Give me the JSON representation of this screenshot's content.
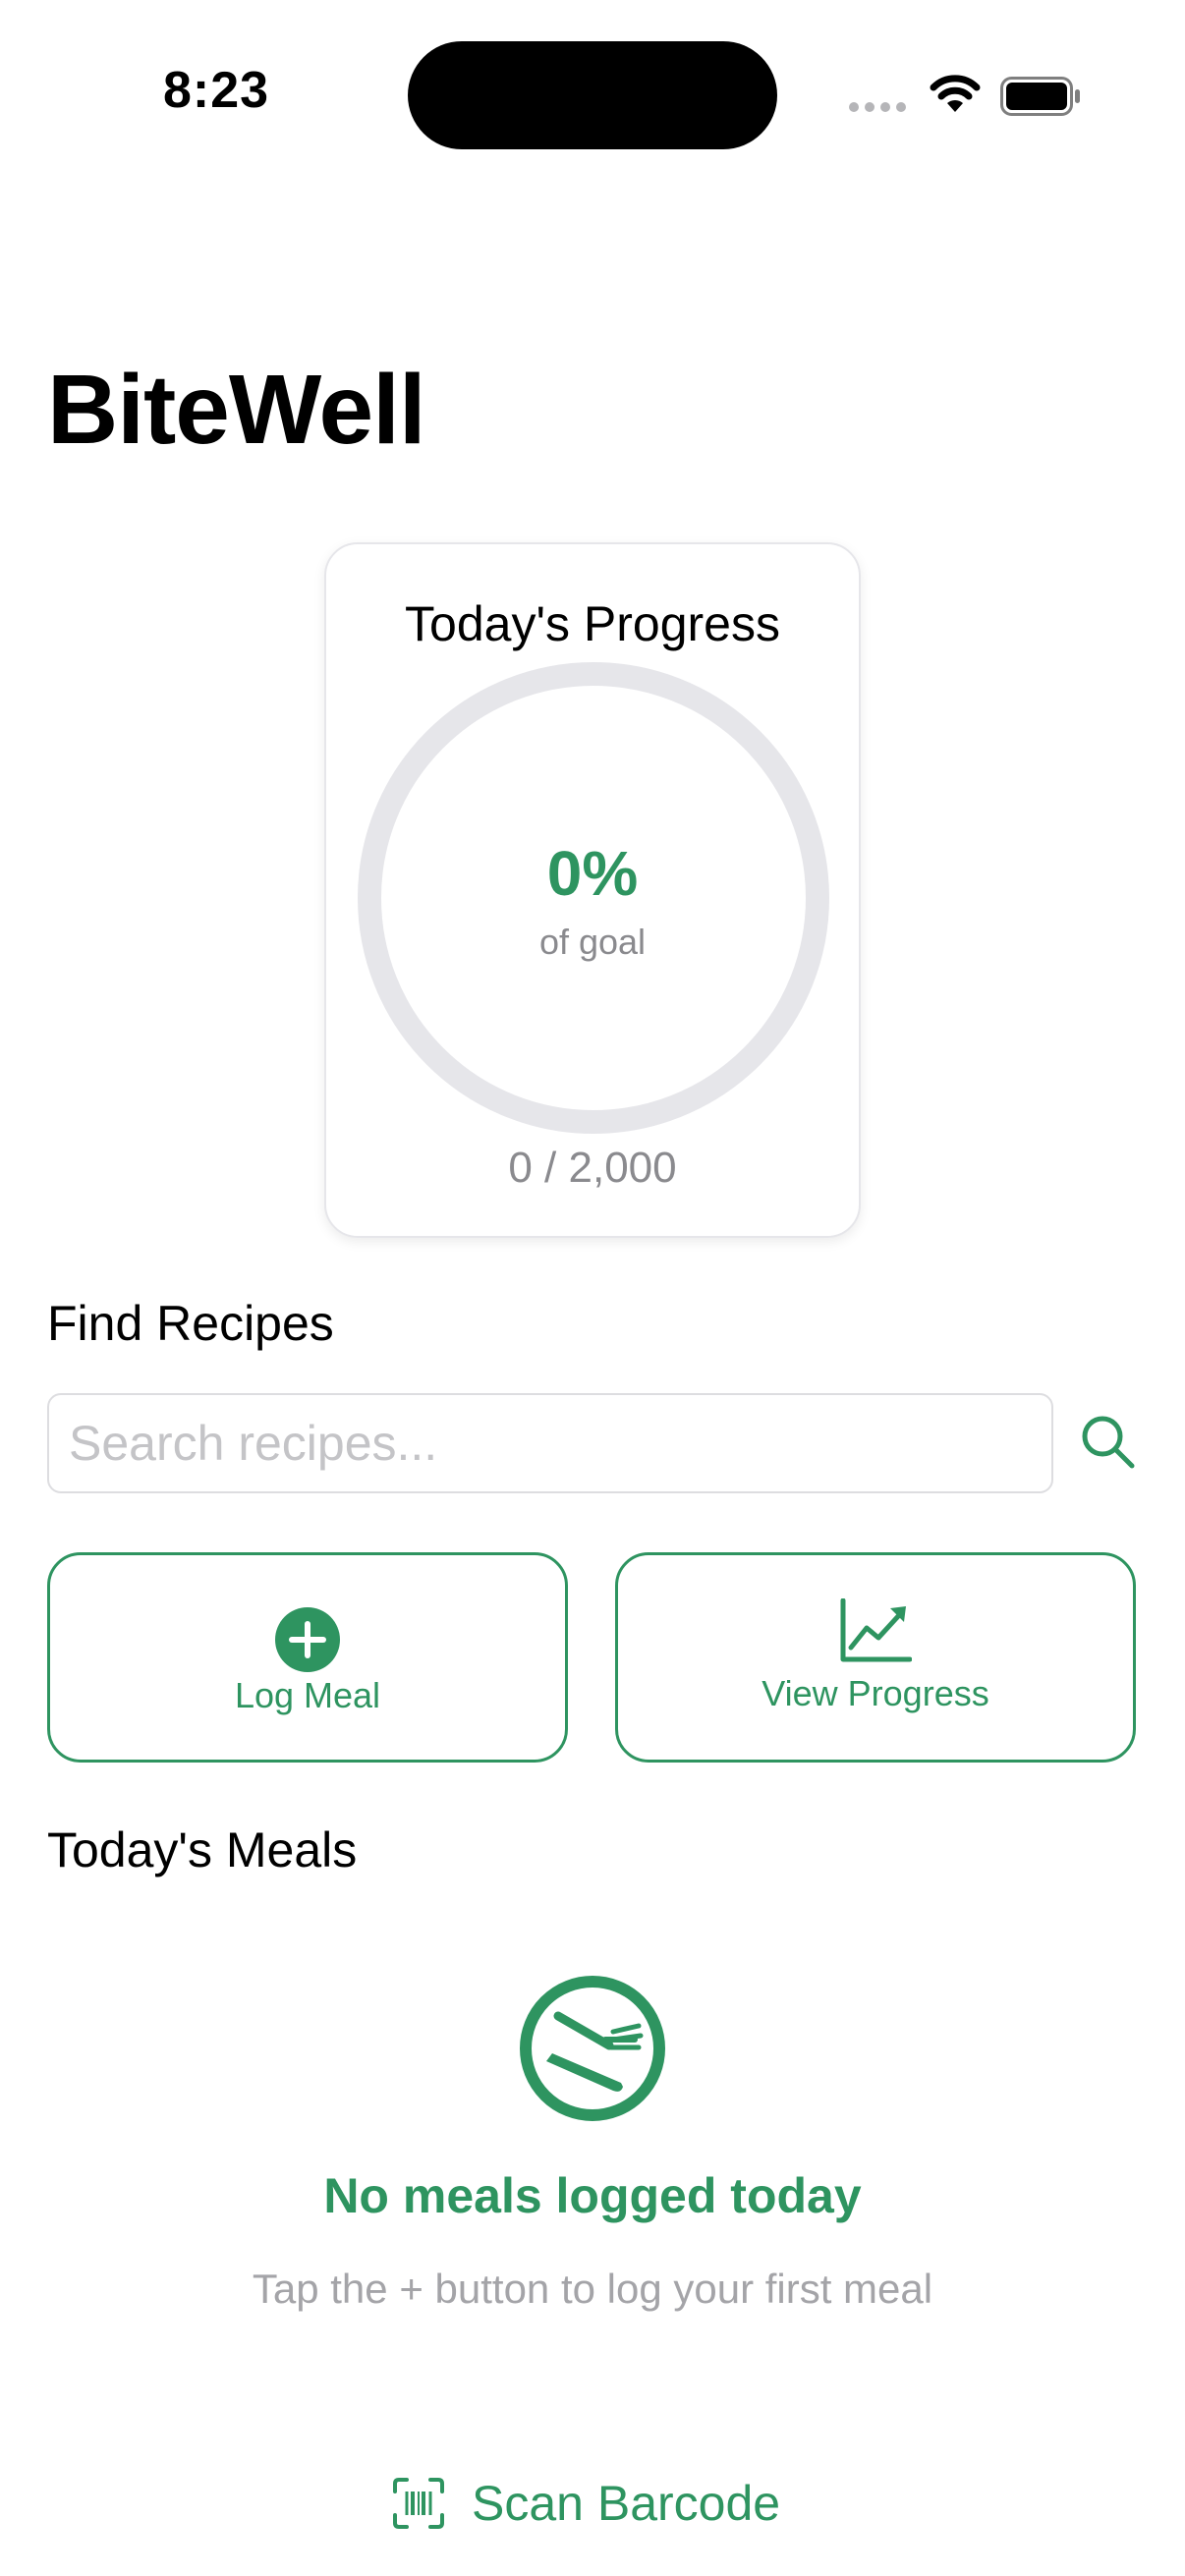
{
  "status_bar": {
    "time": "8:23"
  },
  "app": {
    "title": "BiteWell"
  },
  "progress": {
    "title": "Today's Progress",
    "percent_text": "0%",
    "percent_value": 0,
    "caption": "of goal",
    "count_text": "0 / 2,000"
  },
  "recipes": {
    "heading": "Find Recipes",
    "search_placeholder": "Search recipes...",
    "search_value": ""
  },
  "actions": {
    "log_meal_label": "Log Meal",
    "view_progress_label": "View Progress"
  },
  "meals": {
    "heading": "Today's Meals",
    "empty_title": "No meals logged today",
    "empty_subtitle": "Tap the + button to log your first meal"
  },
  "scan": {
    "label": "Scan Barcode"
  },
  "icons": {
    "search": "search-icon",
    "plus": "plus-circle-icon",
    "chart": "chart-line-icon",
    "fork_knife": "fork-knife-icon",
    "barcode": "barcode-viewfinder-icon"
  },
  "colors": {
    "accent": "#2e9460",
    "ring_track": "#e6e6ea",
    "secondary_text": "#8a8a8e"
  }
}
